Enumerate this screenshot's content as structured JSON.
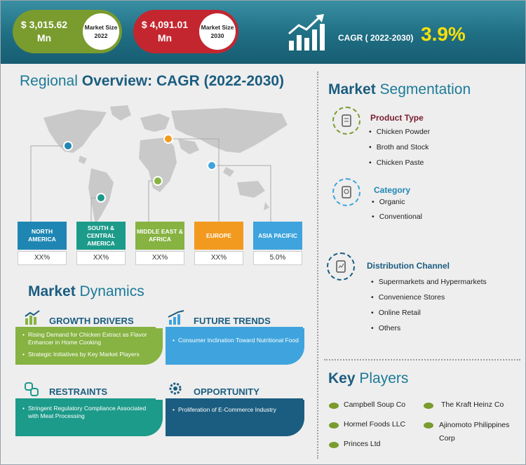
{
  "header": {
    "size_2022_value": "$ 3,015.62 Mn",
    "size_2022_label": "Market Size 2022",
    "size_2030_value": "$ 4,091.01 Mn",
    "size_2030_label": "Market Size 2030",
    "cagr_label": "CAGR ( 2022-2030)",
    "cagr_value": "3.9%"
  },
  "regional": {
    "title_a": "Regional",
    "title_b": " Overview: CAGR (2022-2030)",
    "regions": [
      {
        "name": "NORTH AMERICA",
        "value": "XX%",
        "color": "#1f86b4"
      },
      {
        "name": "SOUTH & CENTRAL AMERICA",
        "value": "XX%",
        "color": "#1c9a8a"
      },
      {
        "name": "MIDDLE EAST & AFRICA",
        "value": "XX%",
        "color": "#86b341"
      },
      {
        "name": "EUROPE",
        "value": "XX%",
        "color": "#f29a1f"
      },
      {
        "name": "ASIA PACIFIC",
        "value": "5.0%",
        "color": "#3fa4dd"
      }
    ]
  },
  "dynamics": {
    "title_a": "Market",
    "title_b": " Dynamics",
    "growth_drivers": {
      "title": "GROWTH DRIVERS",
      "items": [
        "Rising Demand for Chicken Extract as Flavor Enhancer in Home Cooking",
        "Strategic Initiatives by Key Market Players"
      ]
    },
    "future_trends": {
      "title": "FUTURE TRENDS",
      "items": [
        "Consumer Inclination Toward Nutritional Food"
      ]
    },
    "restraints": {
      "title": "RESTRAINTS",
      "items": [
        "Stringent Regulatory Compliance Associated with Meat Processing"
      ]
    },
    "opportunity": {
      "title": "OPPORTUNITY",
      "items": [
        "Proliferation of E-Commerce Industry"
      ]
    }
  },
  "segmentation": {
    "title_a": "Market",
    "title_b": " Segmentation",
    "product_type": {
      "title": "Product Type",
      "items": [
        "Chicken Powder",
        "Broth and Stock",
        "Chicken Paste"
      ]
    },
    "category": {
      "title": "Category",
      "items": [
        "Organic",
        "Conventional"
      ]
    },
    "distribution": {
      "title": "Distribution Channel",
      "items": [
        "Supermarkets and Hypermarkets",
        "Convenience Stores",
        "Online Retail",
        "Others"
      ]
    }
  },
  "key_players": {
    "title_a": "Key",
    "title_b": " Players",
    "items": [
      "Campbell Soup Co",
      "The Kraft Heinz Co",
      "Hormel Foods LLC",
      "Ajinomoto Philippines Corp",
      "Princes Ltd"
    ]
  },
  "colors": {
    "teal": "#1f6e83",
    "green": "#7a9b2e",
    "red": "#c4262f",
    "yellow": "#f5e10a"
  }
}
